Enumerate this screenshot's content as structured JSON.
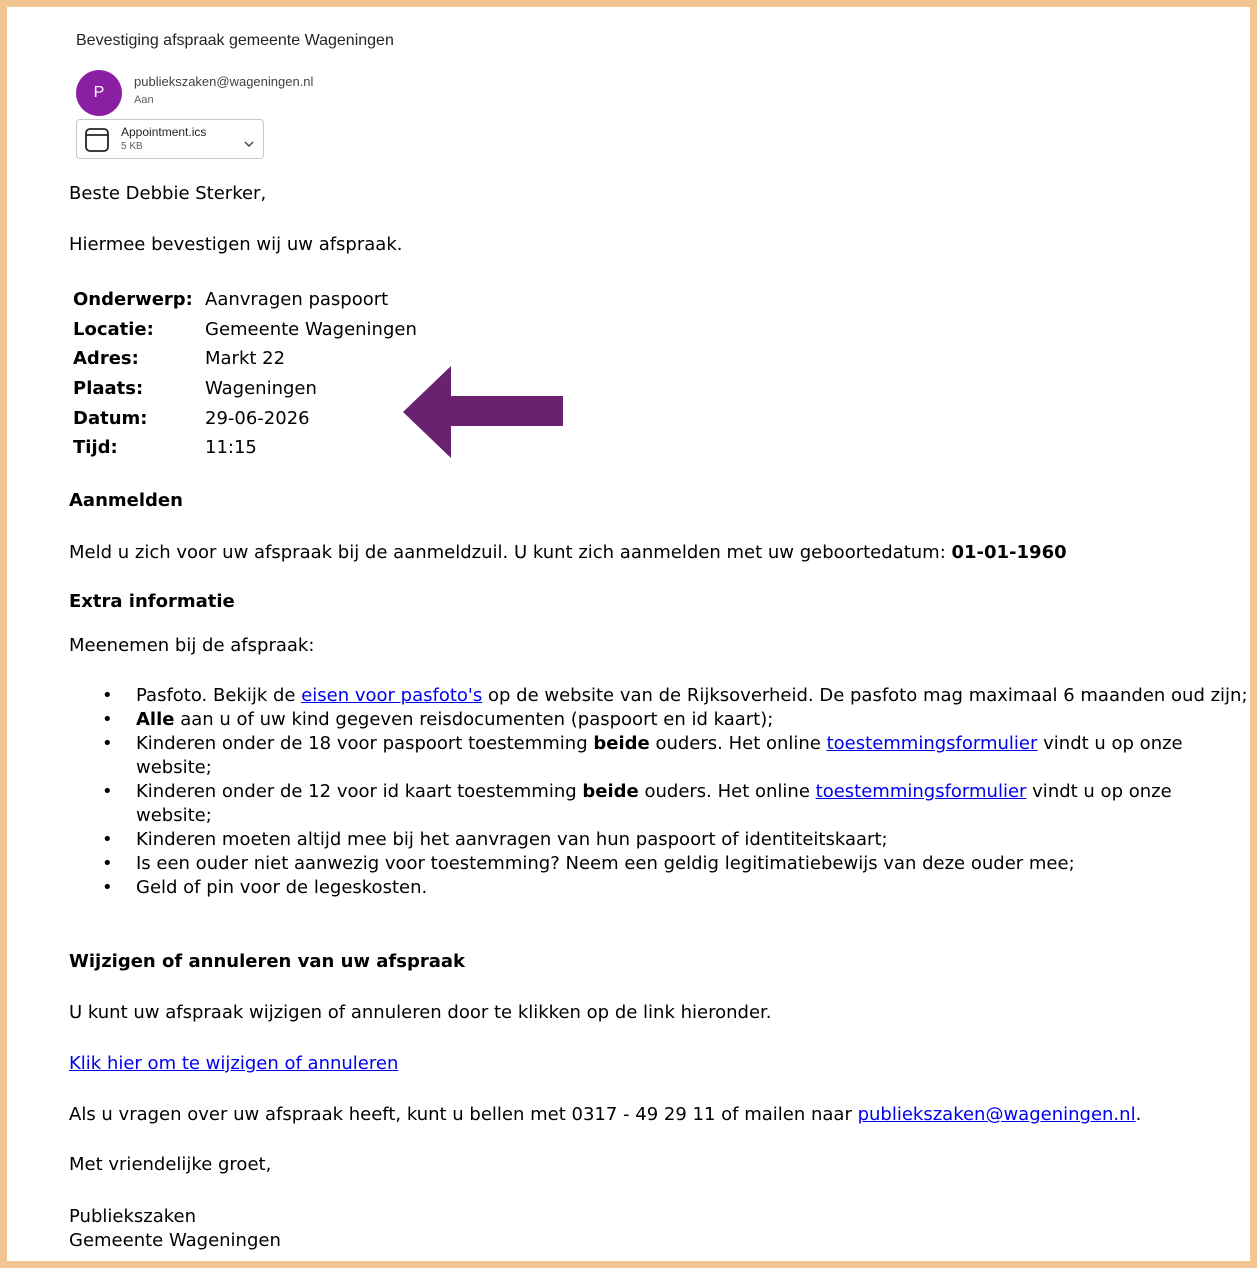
{
  "email": {
    "subject": "Bevestiging afspraak gemeente Wageningen",
    "avatar_letter": "P",
    "avatar_color": "#8b1fa3",
    "sender": "publiekszaken@wageningen.nl",
    "to_label": "Aan",
    "attachment": {
      "name": "Appointment.ics",
      "size": "5 KB",
      "icon": "calendar-file-icon"
    }
  },
  "body": {
    "greeting": "Beste Debbie Sterker,",
    "intro": "Hiermee bevestigen wij uw afspraak.",
    "details": [
      {
        "label": "Onderwerp:",
        "value": "Aanvragen paspoort"
      },
      {
        "label": "Locatie:",
        "value": "Gemeente Wageningen"
      },
      {
        "label": "Adres:",
        "value": "Markt 22"
      },
      {
        "label": "Plaats:",
        "value": "Wageningen"
      },
      {
        "label": "Datum:",
        "value": "29-06-2026"
      },
      {
        "label": "Tijd:",
        "value": "11:15"
      }
    ],
    "arrow_color": "#6a2270",
    "aanmelden_heading": "Aanmelden",
    "aanmelden_text": "Meld u zich voor uw afspraak bij de aanmeldzuil. U kunt zich aanmelden met uw geboortedatum: ",
    "aanmelden_date": "01-01-1960",
    "extra_heading": "Extra informatie",
    "extra_intro": "Meenemen bij de afspraak:",
    "list": {
      "item1_a": "Pasfoto. Bekijk de ",
      "item1_link": "eisen voor pasfoto's",
      "item1_b": " op de website van de Rijksoverheid. De pasfoto mag maximaal 6 maanden oud zijn;",
      "item2_bold": "Alle",
      "item2_rest": " aan u of uw kind gegeven reisdocumenten (paspoort en id kaart);",
      "item3_a": "Kinderen onder de 18 voor paspoort toestemming ",
      "item3_bold": "beide",
      "item3_b": " ouders. Het online ",
      "item3_link": "toestemmingsformulier",
      "item3_c": " vindt u op onze website;",
      "item4_a": "Kinderen onder de 12 voor id kaart toestemming ",
      "item4_bold": "beide",
      "item4_b": " ouders. Het online ",
      "item4_link": "toestemmingsformulier",
      "item4_c": " vindt u op onze website;",
      "item5": "Kinderen moeten altijd mee bij het aanvragen van hun paspoort of identiteitskaart;",
      "item6": "Is een ouder niet aanwezig voor toestemming? Neem een geldig legitimatiebewijs van deze ouder mee;",
      "item7": "Geld of pin voor de legeskosten."
    },
    "change_heading": "Wijzigen of annuleren van uw afspraak",
    "change_text": "U kunt uw afspraak wijzigen of annuleren door te klikken op de link hieronder.",
    "change_link": "Klik hier om te wijzigen of annuleren",
    "contact_text": "Als u vragen over uw afspraak heeft, kunt u bellen met 0317 - 49 29 11 of mailen naar ",
    "contact_email": "publiekszaken@wageningen.nl",
    "contact_end": ".",
    "closing": "Met vriendelijke groet,",
    "signature_line1": "Publiekszaken",
    "signature_line2": "Gemeente Wageningen"
  }
}
